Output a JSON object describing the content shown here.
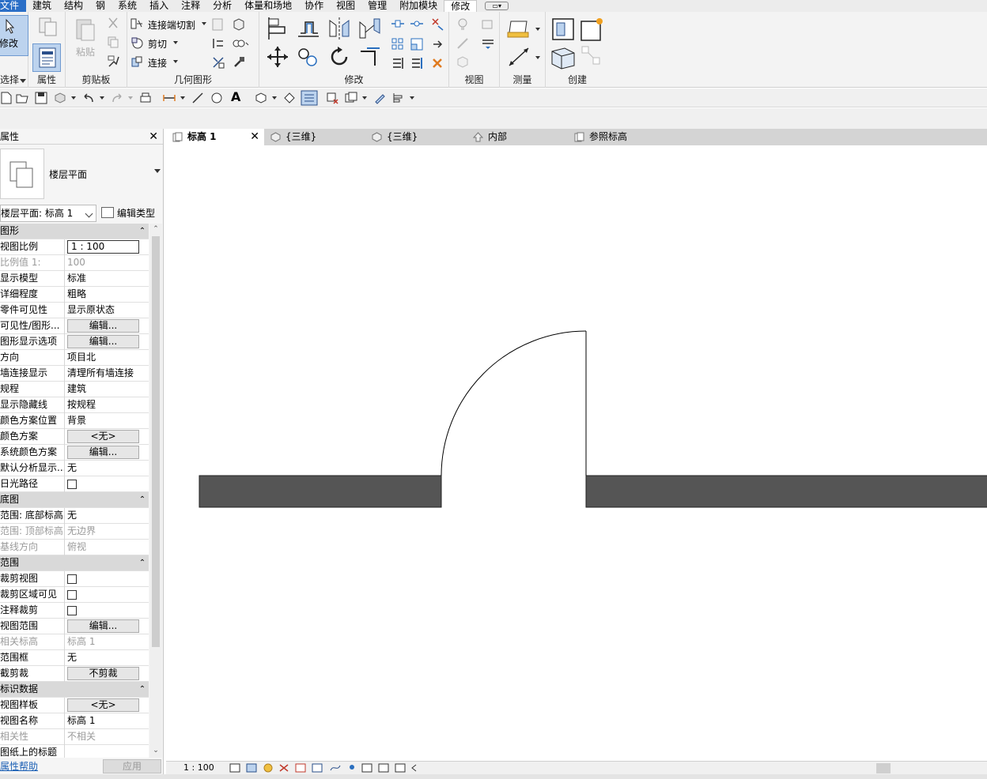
{
  "menu": {
    "items": [
      "文件",
      "建筑",
      "结构",
      "钢",
      "系统",
      "插入",
      "注释",
      "分析",
      "体量和场地",
      "协作",
      "视图",
      "管理",
      "附加模块",
      "修改"
    ],
    "active_index": 13
  },
  "ribbon": {
    "panels": {
      "select": {
        "label": "选择",
        "modify_label": "修改"
      },
      "properties": {
        "label": "属性"
      },
      "clipboard": {
        "label": "剪贴板",
        "paste_label": "粘贴"
      },
      "geometry": {
        "label": "几何图形",
        "cut_join_label": "连接端切割",
        "cut_label": "剪切",
        "join_label": "连接"
      },
      "modify": {
        "label": "修改"
      },
      "view": {
        "label": "视图"
      },
      "measure": {
        "label": "测量"
      },
      "create": {
        "label": "创建"
      }
    }
  },
  "properties": {
    "title": "属性",
    "type_name": "楼层平面",
    "instance_selector": "楼层平面: 标高 1",
    "edit_type_label": "编辑类型",
    "help_label": "属性帮助",
    "apply_label": "应用",
    "sections": [
      {
        "name": "图形",
        "rows": [
          {
            "key": "视图比例",
            "value": "1 : 100",
            "kind": "box"
          },
          {
            "key": "比例值 1:",
            "value": "100",
            "kind": "ro"
          },
          {
            "key": "显示模型",
            "value": "标准",
            "kind": "text"
          },
          {
            "key": "详细程度",
            "value": "粗略",
            "kind": "text"
          },
          {
            "key": "零件可见性",
            "value": "显示原状态",
            "kind": "text"
          },
          {
            "key": "可见性/图形...",
            "value": "编辑...",
            "kind": "button"
          },
          {
            "key": "图形显示选项",
            "value": "编辑...",
            "kind": "button"
          },
          {
            "key": "方向",
            "value": "项目北",
            "kind": "text"
          },
          {
            "key": "墙连接显示",
            "value": "清理所有墙连接",
            "kind": "text"
          },
          {
            "key": "规程",
            "value": "建筑",
            "kind": "text"
          },
          {
            "key": "显示隐藏线",
            "value": "按规程",
            "kind": "text"
          },
          {
            "key": "颜色方案位置",
            "value": "背景",
            "kind": "text"
          },
          {
            "key": "颜色方案",
            "value": "<无>",
            "kind": "button"
          },
          {
            "key": "系统颜色方案",
            "value": "编辑...",
            "kind": "button"
          },
          {
            "key": "默认分析显示...",
            "value": "无",
            "kind": "text"
          },
          {
            "key": "日光路径",
            "value": "",
            "kind": "check"
          }
        ]
      },
      {
        "name": "底图",
        "rows": [
          {
            "key": "范围: 底部标高",
            "value": "无",
            "kind": "text"
          },
          {
            "key": "范围: 顶部标高",
            "value": "无边界",
            "kind": "ro"
          },
          {
            "key": "基线方向",
            "value": "俯视",
            "kind": "ro"
          }
        ]
      },
      {
        "name": "范围",
        "rows": [
          {
            "key": "裁剪视图",
            "value": "",
            "kind": "check"
          },
          {
            "key": "裁剪区域可见",
            "value": "",
            "kind": "check"
          },
          {
            "key": "注释裁剪",
            "value": "",
            "kind": "check"
          },
          {
            "key": "视图范围",
            "value": "编辑...",
            "kind": "button"
          },
          {
            "key": "相关标高",
            "value": "标高 1",
            "kind": "ro"
          },
          {
            "key": "范围框",
            "value": "无",
            "kind": "text"
          },
          {
            "key": "截剪裁",
            "value": "不剪裁",
            "kind": "button"
          }
        ]
      },
      {
        "name": "标识数据",
        "rows": [
          {
            "key": "视图样板",
            "value": "<无>",
            "kind": "button"
          },
          {
            "key": "视图名称",
            "value": "标高 1",
            "kind": "text"
          },
          {
            "key": "相关性",
            "value": "不相关",
            "kind": "ro"
          },
          {
            "key": "图纸上的标题",
            "value": "",
            "kind": "text"
          }
        ]
      }
    ]
  },
  "tabs": [
    {
      "label": "标高 1",
      "icon": "floor-plan-icon",
      "active": true
    },
    {
      "label": "{三维}",
      "icon": "3d-view-icon",
      "active": false
    },
    {
      "label": "{三维}",
      "icon": "3d-view-icon",
      "active": false
    },
    {
      "label": "内部",
      "icon": "elevation-icon",
      "active": false
    },
    {
      "label": "参照标高",
      "icon": "floor-plan-icon",
      "active": false
    }
  ],
  "status": {
    "scale": "1 : 100"
  },
  "colors": {
    "wall_fill": "#555555",
    "menu_active_blue": "#2b6fc7",
    "selected_tool": "#bcd3ee"
  }
}
